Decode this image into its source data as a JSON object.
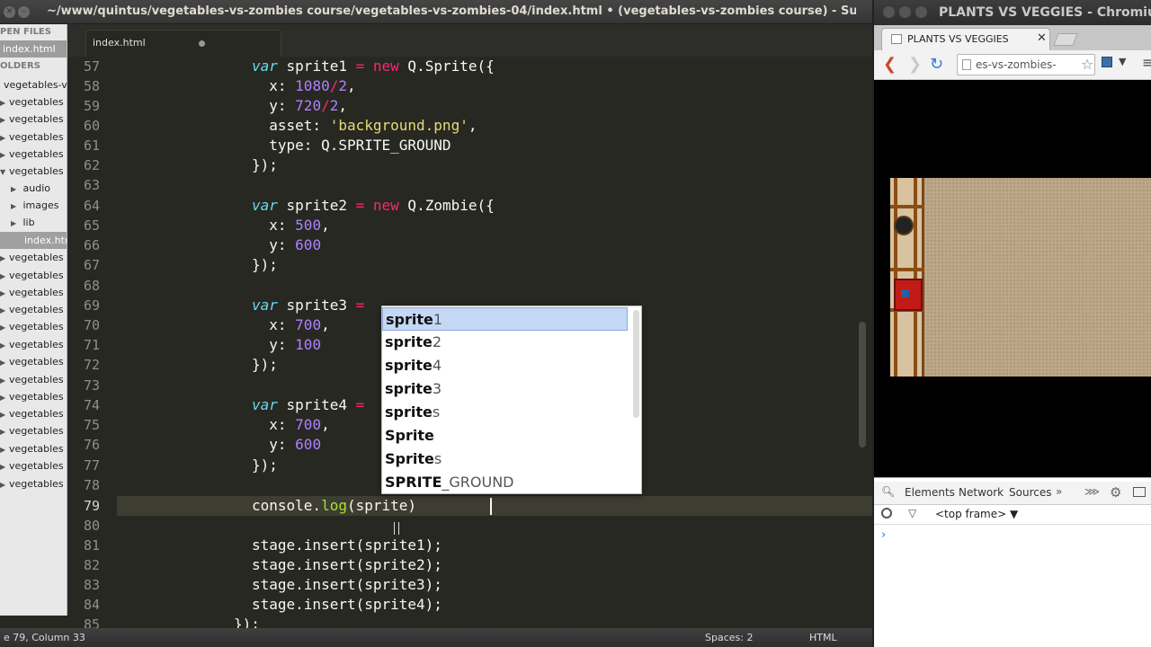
{
  "sublime": {
    "window_title": "~/www/quintus/vegetables-vs-zombies course/vegetables-vs-zombies-04/index.html • (vegetables-vs-zombies course) - Sublime Te",
    "tab_label": "index.html",
    "sidebar": {
      "open_files_header": "PEN FILES",
      "open_file": "index.html",
      "folders_header": "OLDERS",
      "root_folder": "vegetables-v",
      "items": [
        "vegetables",
        "vegetables",
        "vegetables",
        "vegetables",
        "vegetables"
      ],
      "subfolders": [
        "audio",
        "images",
        "lib"
      ],
      "selected_file": "index.htm",
      "items_after": [
        "vegetables",
        "vegetables",
        "vegetables",
        "vegetables",
        "vegetables",
        "vegetables",
        "vegetables",
        "vegetables",
        "vegetables",
        "vegetables",
        "vegetables",
        "vegetables",
        "vegetables",
        "vegetables"
      ]
    },
    "line_numbers": [
      "57",
      "58",
      "59",
      "60",
      "61",
      "62",
      "63",
      "64",
      "65",
      "66",
      "67",
      "68",
      "69",
      "70",
      "71",
      "72",
      "73",
      "74",
      "75",
      "76",
      "77",
      "78",
      "79",
      "80",
      "81",
      "82",
      "83",
      "84",
      "85"
    ],
    "code": {
      "l57_kw": "var",
      "l57_a": " sprite1 ",
      "l57_op": "=",
      "l57_sp": " ",
      "l57_new": "new",
      "l57_b": " Q.Sprite({",
      "l58_a": "  x: ",
      "l58_n1": "1080",
      "l58_b": "/",
      "l58_n2": "2",
      "l58_c": ",",
      "l59_a": "  y: ",
      "l59_n1": "720",
      "l59_b": "/",
      "l59_n2": "2",
      "l59_c": ",",
      "l60_a": "  asset: ",
      "l60_s": "'background.png'",
      "l60_c": ",",
      "l61": "  type: Q.SPRITE_GROUND",
      "l62": "});",
      "l64_kw": "var",
      "l64_a": " sprite2 ",
      "l64_op": "=",
      "l64_sp": " ",
      "l64_new": "new",
      "l64_b": " Q.Zombie({",
      "l65_a": "  x: ",
      "l65_n": "500",
      "l65_c": ",",
      "l66_a": "  y: ",
      "l66_n": "600",
      "l67": "});",
      "l69_kw": "var",
      "l69_a": " sprite3 ",
      "l69_op": "=",
      "l70_a": "  x: ",
      "l70_n": "700",
      "l70_c": ",",
      "l71_a": "  y: ",
      "l71_n": "100",
      "l72": "});",
      "l74_kw": "var",
      "l74_a": " sprite4 ",
      "l74_op": "=",
      "l75_a": "  x: ",
      "l75_n": "700",
      "l75_c": ",",
      "l76_a": "  y: ",
      "l76_n": "600",
      "l77": "});",
      "l79_a": "console.",
      "l79_fn": "log",
      "l79_b": "(sprite)",
      "l81": "stage.insert(sprite1);",
      "l82": "stage.insert(sprite2);",
      "l83": "stage.insert(sprite3);",
      "l84": "stage.insert(sprite4);",
      "l85": "});"
    },
    "autocomplete": [
      {
        "match": "sprite",
        "rest": "1"
      },
      {
        "match": "sprite",
        "rest": "2"
      },
      {
        "match": "sprite",
        "rest": "4"
      },
      {
        "match": "sprite",
        "rest": "3"
      },
      {
        "match": "sprite",
        "rest": "s"
      },
      {
        "match": "Sprite",
        "rest": ""
      },
      {
        "match": "Sprite",
        "rest": "s"
      },
      {
        "match": "SPRITE",
        "rest": "_GROUND"
      }
    ],
    "status": {
      "position": "e 79, Column 33",
      "spaces": "Spaces: 2",
      "syntax": "HTML"
    }
  },
  "chromium": {
    "window_title": "PLANTS VS VEGGIES - Chromium",
    "tab_title": "PLANTS VS VEGGIES",
    "tab_close": "✕",
    "url": "es-vs-zombies-",
    "devtools": {
      "tabs": [
        "Elements",
        "Network",
        "Sources"
      ],
      "more": "»",
      "frame_selector": "<top frame> ▼",
      "prompt": "›"
    }
  }
}
